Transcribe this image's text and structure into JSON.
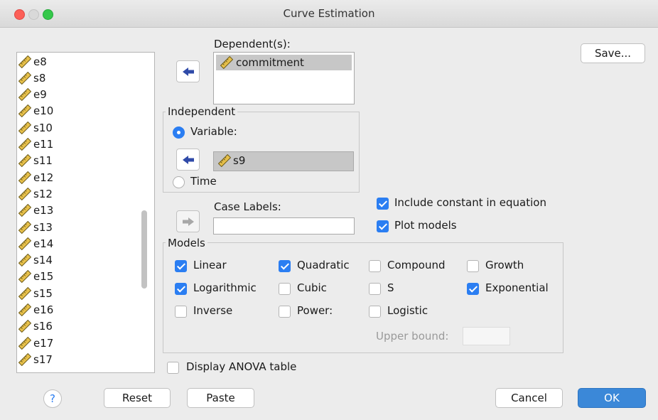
{
  "window": {
    "title": "Curve Estimation"
  },
  "variable_list": {
    "items": [
      "e8",
      "s8",
      "e9",
      "e10",
      "s10",
      "e11",
      "s11",
      "e12",
      "s12",
      "e13",
      "s13",
      "e14",
      "s14",
      "e15",
      "s15",
      "e16",
      "s16",
      "e17",
      "s17"
    ]
  },
  "dependents": {
    "label": "Dependent(s):",
    "items": [
      "commitment"
    ]
  },
  "independent": {
    "group_label": "Independent",
    "variable_label": "Variable:",
    "variable_value": "s9",
    "time_label": "Time",
    "selected": "Variable"
  },
  "case_labels": {
    "label": "Case Labels:",
    "value": ""
  },
  "options": {
    "include_constant": {
      "label": "Include constant in equation",
      "checked": true
    },
    "plot_models": {
      "label": "Plot models",
      "checked": true
    },
    "display_anova": {
      "label": "Display ANOVA table",
      "checked": false
    }
  },
  "models": {
    "group_label": "Models",
    "linear": {
      "label": "Linear",
      "checked": true
    },
    "quadratic": {
      "label": "Quadratic",
      "checked": true
    },
    "compound": {
      "label": "Compound",
      "checked": false
    },
    "growth": {
      "label": "Growth",
      "checked": false
    },
    "logarithmic": {
      "label": "Logarithmic",
      "checked": true
    },
    "cubic": {
      "label": "Cubic",
      "checked": false
    },
    "s": {
      "label": "S",
      "checked": false
    },
    "exponential": {
      "label": "Exponential",
      "checked": true
    },
    "inverse": {
      "label": "Inverse",
      "checked": false
    },
    "power": {
      "label": "Power:",
      "checked": false
    },
    "logistic": {
      "label": "Logistic",
      "checked": false
    },
    "upper_bound_label": "Upper bound:",
    "upper_bound_value": ""
  },
  "buttons": {
    "save": "Save...",
    "help": "?",
    "reset": "Reset",
    "paste": "Paste",
    "cancel": "Cancel",
    "ok": "OK"
  },
  "colors": {
    "accent": "#2b7ef2",
    "ok_button": "#3b88d8",
    "selection": "#c7c7c7"
  },
  "icons": {
    "variable": "scale-ruler-icon",
    "move_right": "arrow-right-icon",
    "move_left": "arrow-left-icon",
    "help": "question-icon"
  }
}
